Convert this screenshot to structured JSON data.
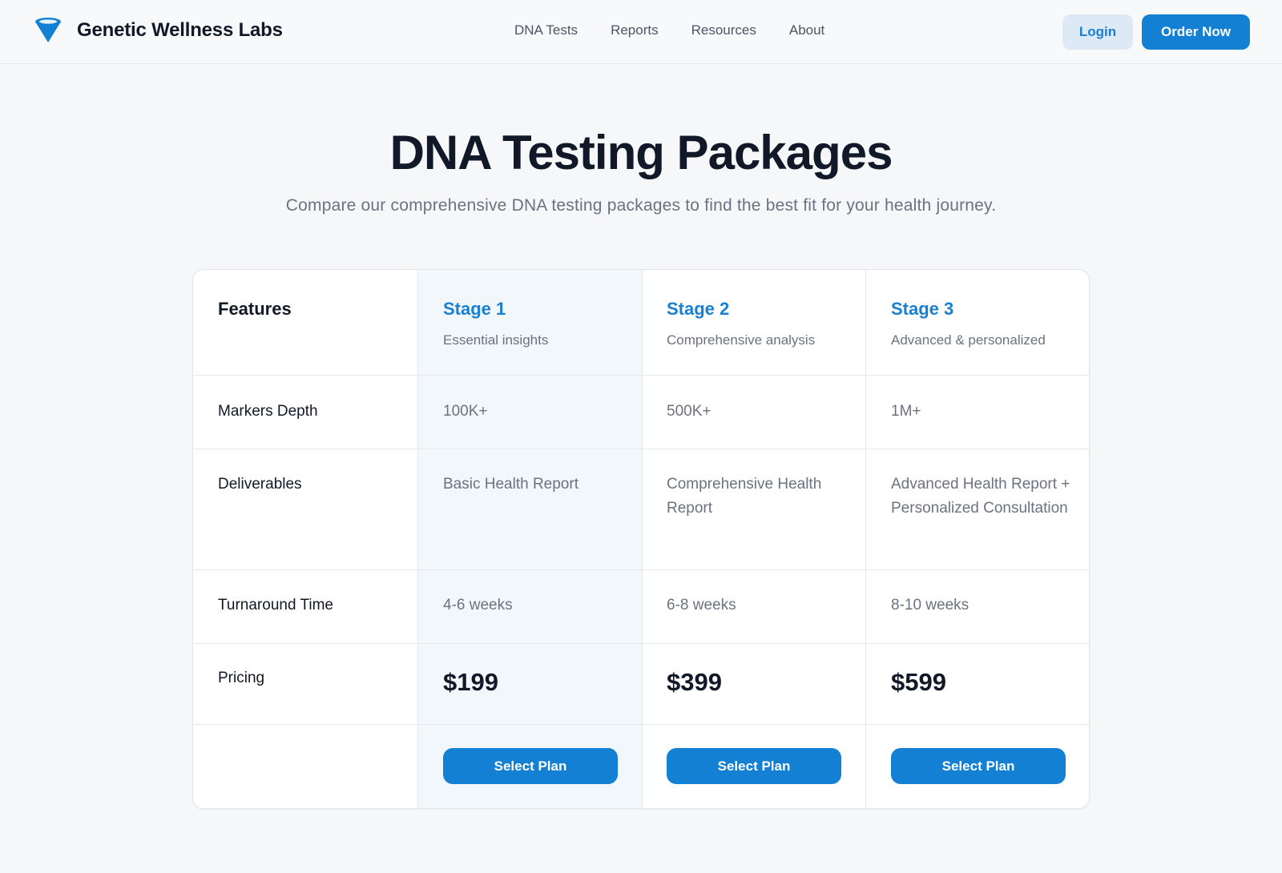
{
  "header": {
    "brand": "Genetic Wellness Labs",
    "nav": [
      "DNA Tests",
      "Reports",
      "Resources",
      "About"
    ],
    "login_label": "Login",
    "order_label": "Order Now"
  },
  "hero": {
    "title": "DNA Testing Packages",
    "subtitle": "Compare our comprehensive DNA testing packages to find the best fit for your health journey."
  },
  "table": {
    "features_header": "Features",
    "plans": [
      {
        "title": "Stage 1",
        "subtitle": "Essential insights",
        "markers": "100K+",
        "deliverables": "Basic Health Report",
        "turnaround": "4-6 weeks",
        "price": "$199",
        "button": "Select Plan"
      },
      {
        "title": "Stage 2",
        "subtitle": "Comprehensive analysis",
        "markers": "500K+",
        "deliverables": "Comprehensive Health Report",
        "turnaround": "6-8 weeks",
        "price": "$399",
        "button": "Select Plan"
      },
      {
        "title": "Stage 3",
        "subtitle": "Advanced & personalized",
        "markers": "1M+",
        "deliverables": "Advanced Health Report + Personalized Consultation",
        "turnaround": "8-10 weeks",
        "price": "$599",
        "button": "Select Plan"
      }
    ],
    "rows": [
      "Markers Depth",
      "Deliverables",
      "Turnaround Time",
      "Pricing"
    ]
  },
  "colors": {
    "accent": "#1480d4",
    "highlight_column": "#f2f7fc",
    "background": "#f5f7f9"
  }
}
